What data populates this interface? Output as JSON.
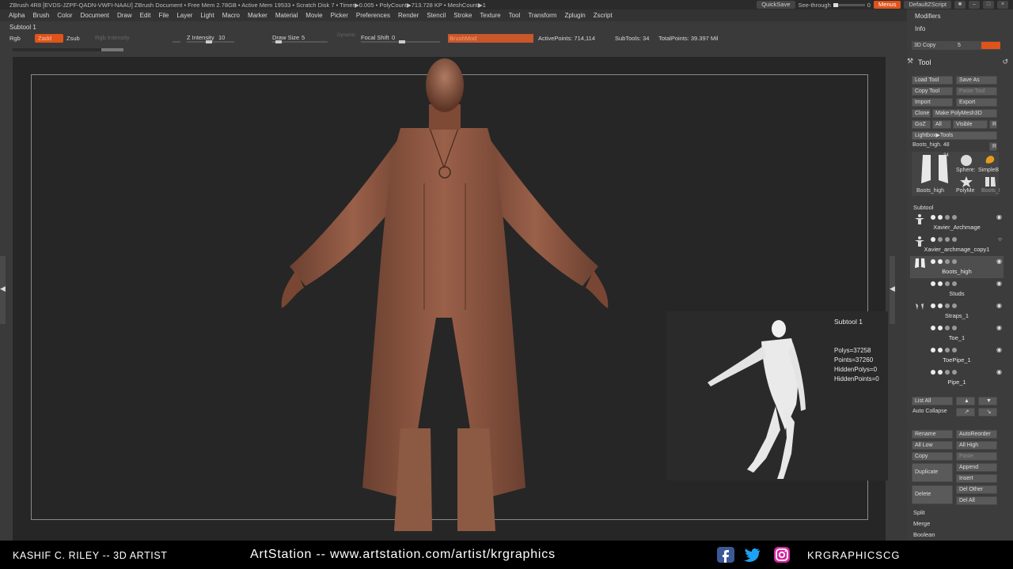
{
  "titlebar": {
    "title": "ZBrush 4R8 [EVDS-JZPF-QADN-VWFI-NAAU]    ZBrush Document      • Free Mem 2.78GB • Active Mem 19533 • Scratch Disk 7 • Timer▶0.005 • PolyCount▶713.728 KP  • MeshCount▶1",
    "quicksave": "QuickSave",
    "see_through_label": "See-through",
    "see_through_value": "0",
    "menus_btn": "Menus",
    "default_zscript": "DefaultZScript"
  },
  "menubar": [
    "Alpha",
    "Brush",
    "Color",
    "Document",
    "Draw",
    "Edit",
    "File",
    "Layer",
    "Light",
    "Macro",
    "Marker",
    "Material",
    "Movie",
    "Picker",
    "Preferences",
    "Render",
    "Stencil",
    "Stroke",
    "Texture",
    "Tool",
    "Transform",
    "Zplugin",
    "Zscript"
  ],
  "toolbar": {
    "subtool_label": "Subtool 1",
    "rgb": "Rgb",
    "zadd": "Zadd",
    "zsub": "Zsub",
    "rgb_intensity": "Rgb Intensity",
    "z_intensity_label": "Z Intensity",
    "z_intensity_value": "10",
    "draw_size_label": "Draw Size",
    "draw_size_value": "5",
    "dynamic": "Dynamic",
    "focal_shift_label": "Focal Shift",
    "focal_shift_value": "0",
    "brushmod": "BrushMod",
    "active_points": "ActivePoints: 714,114",
    "subtools": "SubTools: 34",
    "total_points": "TotalPoints: 39.397 Mil"
  },
  "preview": {
    "name": "Subtool 1",
    "polys": "Polys=37258",
    "points": "Points=37260",
    "hidden_polys": "HiddenPolys=0",
    "hidden_points": "HiddenPoints=0"
  },
  "right_panel": {
    "modifiers": "Modifiers",
    "info": "Info",
    "copy3d": "3D Copy",
    "copy3d_value": "5",
    "tool_title": "Tool",
    "load_tool": "Load Tool",
    "save_as": "Save As",
    "copy_tool": "Copy Tool",
    "paste_tool": "Paste Tool",
    "import": "Import",
    "export": "Export",
    "clone": "Clone",
    "make_polymesh": "Make PolyMesh3D",
    "goz": "GoZ",
    "all": "All",
    "visible": "Visible",
    "r": "R",
    "lightbox_tools": "Lightbox▶Tools",
    "current_tool": "Boots_high. 48",
    "r2": "R",
    "thumb_count": "34",
    "thumb_boots": "Boots_high",
    "thumb_sphere": "Sphere:",
    "thumb_simple": "SimpleB",
    "thumb_polyme": "PolyMe",
    "thumb_boots2": "Boots_I",
    "subtool_header": "Subtool",
    "subtools": [
      "Xavier_Archmage",
      "Xavier_archmage_copy1",
      "Boots_high",
      "Studs",
      "Straps_1",
      "Toe_1",
      "ToePipe_1",
      "Pipe_1"
    ],
    "list_all": "List All",
    "auto_collapse": "Auto Collapse",
    "rename": "Rename",
    "auto_reorder": "AutoReorder",
    "all_low": "All Low",
    "all_high": "All High",
    "copy": "Copy",
    "paste": "Paste",
    "duplicate": "Duplicate",
    "append": "Append",
    "insert": "Insert",
    "delete": "Delete",
    "del_other": "Del Other",
    "del_all": "Del All",
    "split": "Split",
    "merge": "Merge",
    "boolean": "Boolean"
  },
  "footer": {
    "artist": "KASHIF C. RILEY -- 3D ARTIST",
    "site": "ArtStation -- www.artstation.com/artist/krgraphics",
    "handle": "KRGRAPHICSCG"
  }
}
